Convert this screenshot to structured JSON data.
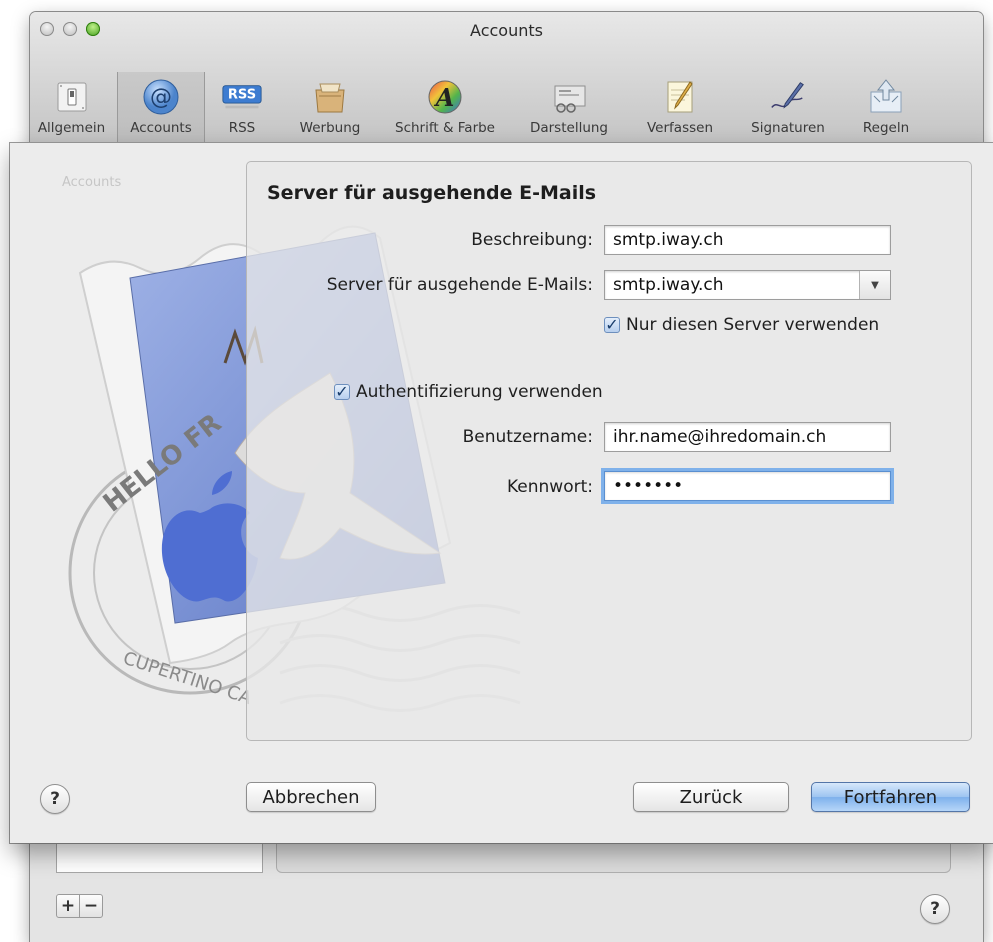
{
  "window": {
    "title": "Accounts"
  },
  "toolbar": {
    "items": [
      {
        "label": "Allgemein",
        "icon": "general-switch-icon"
      },
      {
        "label": "Accounts",
        "icon": "at-sign-icon",
        "selected": true
      },
      {
        "label": "RSS",
        "icon": "rss-icon"
      },
      {
        "label": "Werbung",
        "icon": "junk-mail-icon"
      },
      {
        "label": "Schrift & Farbe",
        "icon": "fonts-colors-icon"
      },
      {
        "label": "Darstellung",
        "icon": "viewing-icon"
      },
      {
        "label": "Verfassen",
        "icon": "composing-icon"
      },
      {
        "label": "Signaturen",
        "icon": "signature-pen-icon"
      },
      {
        "label": "Regeln",
        "icon": "rules-icon"
      }
    ]
  },
  "background": {
    "accounts_label": "Accounts",
    "stamp_text_top": "HELLO FR",
    "stamp_text_bottom": "CUPERTINO CA"
  },
  "sheet": {
    "title": "Server für ausgehende E-Mails",
    "description_label": "Beschreibung:",
    "description_value": "smtp.iway.ch",
    "server_label": "Server für ausgehende E-Mails:",
    "server_value": "smtp.iway.ch",
    "only_this_server_label": "Nur diesen Server verwenden",
    "only_this_server_checked": true,
    "use_auth_label": "Authentifizierung verwenden",
    "use_auth_checked": true,
    "username_label": "Benutzername:",
    "username_value": "ihr.name@ihredomain.ch",
    "password_label": "Kennwort:",
    "password_value": "•••••••",
    "help_label": "?",
    "cancel_label": "Abbrechen",
    "back_label": "Zurück",
    "continue_label": "Fortfahren"
  },
  "footer": {
    "add_label": "+",
    "remove_label": "−",
    "help_label": "?"
  },
  "colors": {
    "default_button": "#7eb1ec",
    "focus_ring": "#7fb1ea",
    "window_bg": "#ececec"
  }
}
